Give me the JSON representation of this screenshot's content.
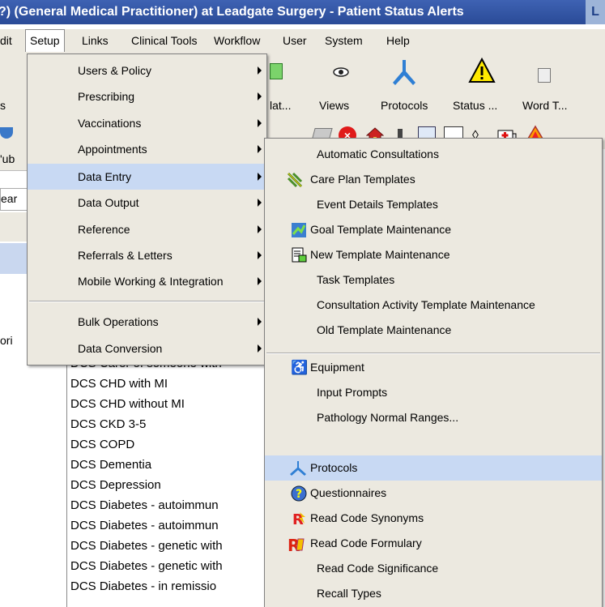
{
  "window": {
    "title": "?) (General Medical Practitioner) at Leadgate Surgery - Patient Status Alerts",
    "corner_label": "L"
  },
  "menubar": {
    "items": [
      "dit",
      "Setup",
      "Links",
      "Clinical Tools",
      "Workflow",
      "User",
      "System",
      "Help"
    ]
  },
  "toolbar": {
    "left_labels": [
      "s"
    ],
    "labels": [
      "lat...",
      "Views",
      "Protocols",
      "Status ...",
      "Word T..."
    ]
  },
  "left_panel": {
    "texts": [
      "'ub",
      "ear",
      "ori"
    ]
  },
  "setup_menu": {
    "items": [
      "Users & Policy",
      "Prescribing",
      "Vaccinations",
      "Appointments",
      "Data Entry",
      "Data Output",
      "Reference",
      "Referrals & Letters",
      "Mobile Working & Integration",
      "Bulk Operations",
      "Data Conversion"
    ],
    "highlighted": "Data Entry"
  },
  "data_entry_menu": {
    "items": [
      "Automatic Consultations",
      "Care Plan Templates",
      "Event Details Templates",
      "Goal Template Maintenance",
      "New Template Maintenance",
      "Task Templates",
      "Consultation Activity Template Maintenance",
      "Old Template Maintenance",
      "Equipment",
      "Input Prompts",
      "Pathology Normal Ranges...",
      "Protocols",
      "Questionnaires",
      "Read Code Synonyms",
      "Read Code Formulary",
      "Read Code Significance",
      "Recall Types"
    ],
    "highlighted": "Protocols"
  },
  "background_list": {
    "rows": [
      "DCS Carer of someone with",
      "DCS CHD with MI",
      "DCS CHD without MI",
      "DCS CKD 3-5",
      "DCS COPD",
      "DCS Dementia",
      "DCS Depression",
      "DCS Diabetes - autoimmun",
      "DCS Diabetes - autoimmun",
      "DCS Diabetes - genetic with",
      "DCS Diabetes - genetic with",
      "DCS Diabetes - in remissio"
    ]
  },
  "colors": {
    "titlebar": "#2f52a3",
    "menu_bg": "#ece9e0",
    "highlight": "#c8d9f3"
  }
}
